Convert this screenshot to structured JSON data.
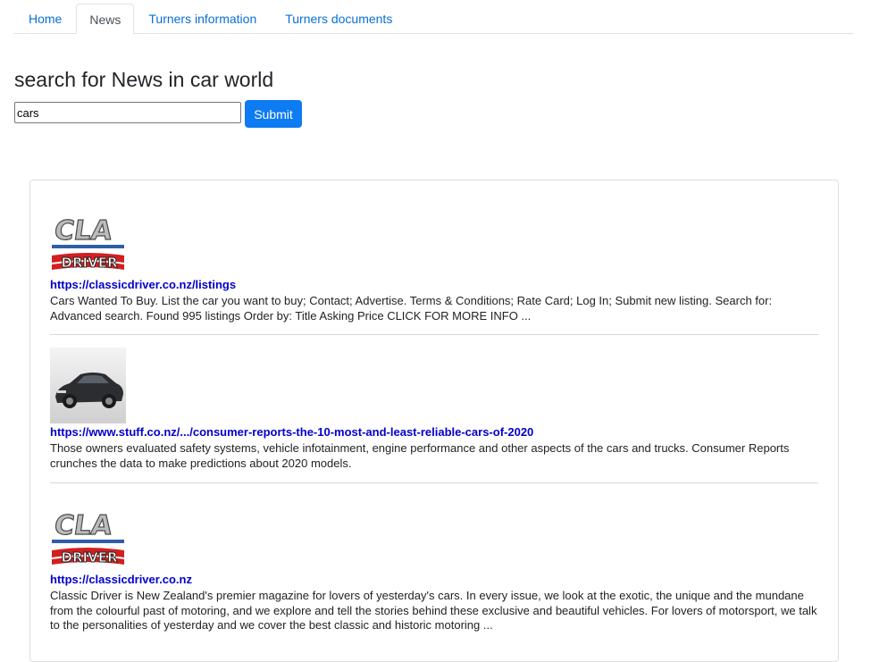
{
  "nav": {
    "tabs": [
      {
        "label": "Home"
      },
      {
        "label": "News"
      },
      {
        "label": "Turners information"
      },
      {
        "label": "Turners documents"
      }
    ],
    "active_index": 1
  },
  "search": {
    "heading": "search for News in car world",
    "query": "cars",
    "submit_label": "Submit"
  },
  "results": [
    {
      "thumbnail": "classic-driver-logo",
      "url": "https://classicdriver.co.nz/listings",
      "description": "Cars Wanted To Buy. List the car you want to buy; Contact; Advertise. Terms & Conditions; Rate Card; Log In; Submit new listing. Search for: Advanced search. Found 995 listings Order by: Title Asking Price CLICK FOR MORE INFO ..."
    },
    {
      "thumbnail": "dark-sedan-photo",
      "url": "https://www.stuff.co.nz/.../consumer-reports-the-10-most-and-least-reliable-cars-of-2020",
      "description": "Those owners evaluated safety systems, vehicle infotainment, engine performance and other aspects of the cars and trucks. Consumer Reports crunches the data to make predictions about 2020 models."
    },
    {
      "thumbnail": "classic-driver-logo",
      "url": "https://classicdriver.co.nz",
      "description": "Classic Driver is New Zealand's premier magazine for lovers of yesterday's cars. In every issue, we look at the exotic, the unique and the mundane from the colourful past of motoring, and we explore and tell the stories behind these exclusive and beautiful vehicles. For lovers of motorsport, we talk to the personalities of yesterday and we cover the best classic and historic motoring ..."
    }
  ],
  "colors": {
    "link": "#0000cc",
    "nav_link": "#0a6fd4",
    "button": "#0d7bf2"
  }
}
